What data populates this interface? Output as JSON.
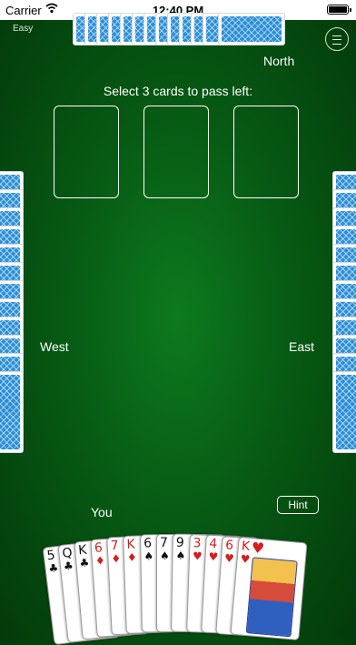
{
  "status_bar": {
    "carrier": "Carrier",
    "time": "12:40 PM"
  },
  "difficulty": "Easy",
  "players": {
    "north": "North",
    "west": "West",
    "east": "East",
    "south": "You"
  },
  "pass_instruction": "Select 3 cards to pass left:",
  "hint_label": "Hint",
  "icons": {
    "menu": "hamburger-menu-icon",
    "wifi": "wifi-icon",
    "battery": "battery-icon"
  },
  "colors": {
    "table_green": "#0d7a1e",
    "card_back_blue": "#2b8fd8",
    "red_suit": "#d21f1f"
  },
  "hand": [
    {
      "rank": "5",
      "suit": "♣",
      "color": "black"
    },
    {
      "rank": "Q",
      "suit": "♣",
      "color": "black"
    },
    {
      "rank": "K",
      "suit": "♣",
      "color": "black"
    },
    {
      "rank": "6",
      "suit": "♦",
      "color": "red"
    },
    {
      "rank": "7",
      "suit": "♦",
      "color": "red"
    },
    {
      "rank": "K",
      "suit": "♦",
      "color": "red"
    },
    {
      "rank": "6",
      "suit": "♠",
      "color": "black"
    },
    {
      "rank": "7",
      "suit": "♠",
      "color": "black"
    },
    {
      "rank": "9",
      "suit": "♠",
      "color": "black"
    },
    {
      "rank": "3",
      "suit": "♥",
      "color": "red"
    },
    {
      "rank": "4",
      "suit": "♥",
      "color": "red"
    },
    {
      "rank": "6",
      "suit": "♥",
      "color": "red"
    },
    {
      "rank": "K",
      "suit": "♥",
      "color": "red"
    }
  ]
}
